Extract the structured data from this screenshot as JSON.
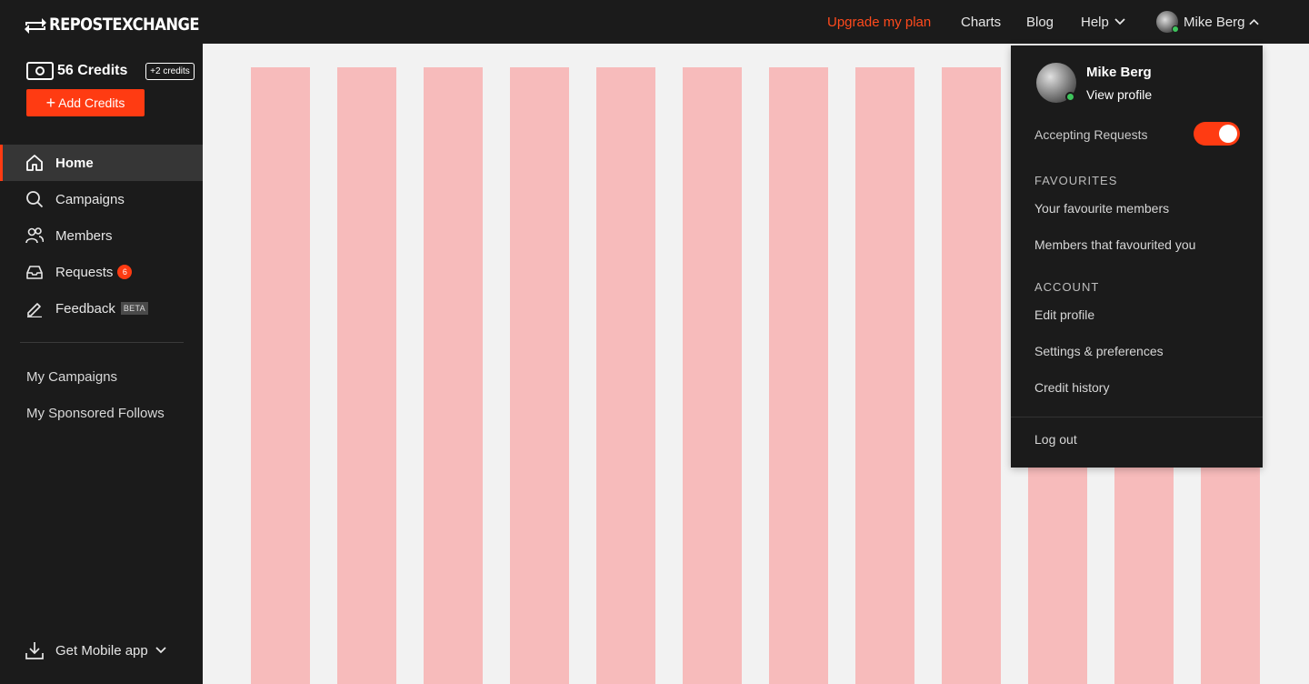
{
  "brand": {
    "name": "REPOSTEXCHANGE"
  },
  "topnav": {
    "upgrade": "Upgrade my plan",
    "charts": "Charts",
    "blog": "Blog",
    "help": "Help",
    "user": "Mike Berg"
  },
  "sidebar": {
    "credits": "56 Credits",
    "bonus": "+2 credits",
    "add_credits": "Add Credits",
    "items": [
      {
        "label": "Home",
        "icon": "home-icon",
        "active": true
      },
      {
        "label": "Campaigns",
        "icon": "search-icon"
      },
      {
        "label": "Members",
        "icon": "users-icon"
      },
      {
        "label": "Requests",
        "icon": "inbox-icon",
        "badge": "6"
      },
      {
        "label": "Feedback",
        "icon": "pencil-icon",
        "tag": "BETA"
      }
    ],
    "links": [
      "My Campaigns",
      "My Sponsored Follows"
    ],
    "mobile": "Get Mobile app"
  },
  "dropdown": {
    "name": "Mike Berg",
    "view_profile": "View profile",
    "accepting": "Accepting Requests",
    "accepting_on": true,
    "favourites_title": "FAVOURITES",
    "favourites": [
      "Your favourite members",
      "Members that favourited you"
    ],
    "account_title": "ACCOUNT",
    "account": [
      "Edit profile",
      "Settings & preferences",
      "Credit history"
    ],
    "logout": "Log out"
  },
  "colors": {
    "accent": "#ff3b12",
    "upgrade": "#ff4a1c",
    "dark": "#1b1b1b",
    "placeholder": "#f7bbbb",
    "online": "#3ec45c"
  }
}
